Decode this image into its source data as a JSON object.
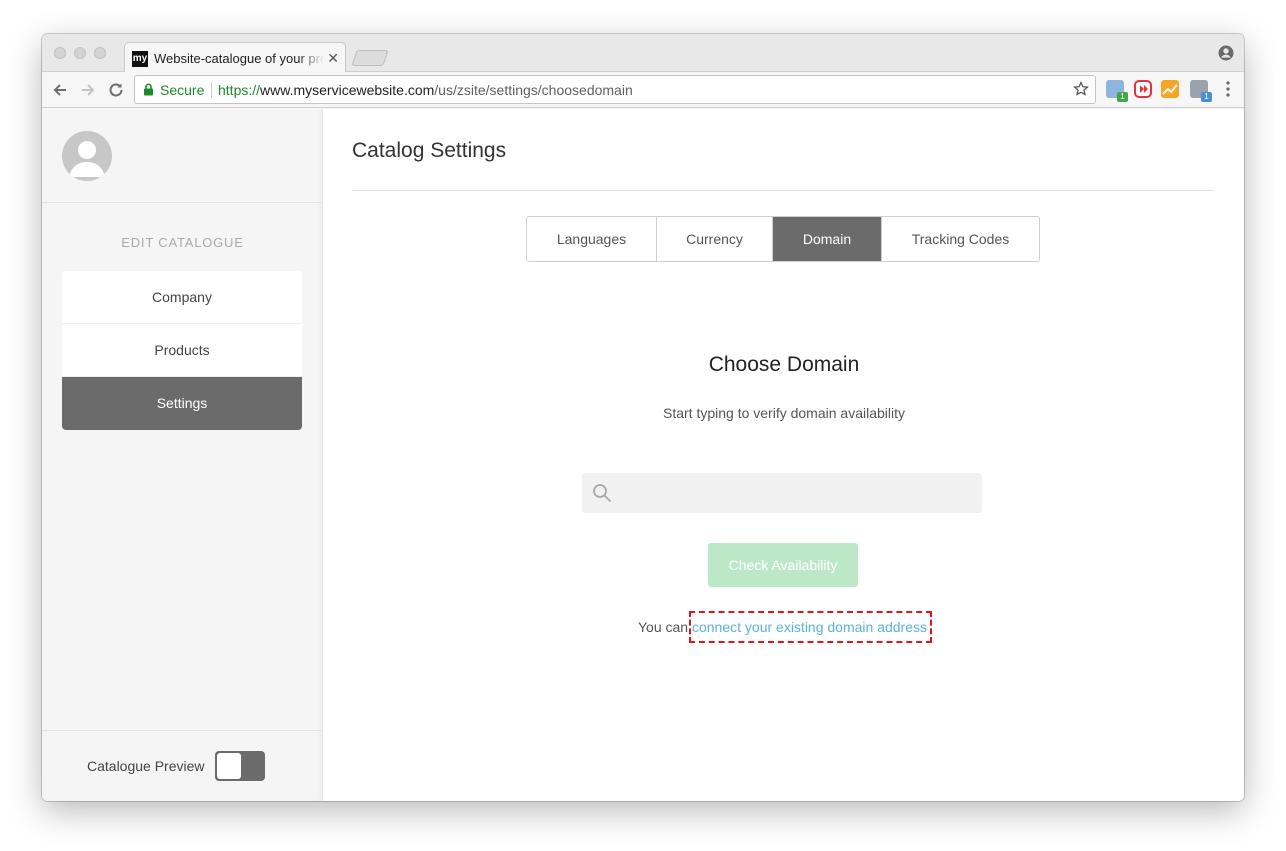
{
  "browser": {
    "tab_title": "Website-catalogue of your products",
    "tab_favicon": "my",
    "secure_label": "Secure",
    "url_scheme": "https://",
    "url_host": "www.myservicewebsite.com",
    "url_path": "/us/zsite/settings/choosedomain",
    "extension_badges": [
      "1",
      "1"
    ]
  },
  "sidebar": {
    "heading": "EDIT CATALOGUE",
    "items": [
      {
        "label": "Company",
        "active": false
      },
      {
        "label": "Products",
        "active": false
      },
      {
        "label": "Settings",
        "active": true
      }
    ],
    "preview_label": "Catalogue Preview",
    "preview_enabled": false
  },
  "main": {
    "title": "Catalog Settings",
    "tabs": [
      {
        "label": "Languages",
        "active": false
      },
      {
        "label": "Currency",
        "active": false
      },
      {
        "label": "Domain",
        "active": true
      },
      {
        "label": "Tracking Codes",
        "active": false
      }
    ],
    "domain": {
      "heading": "Choose Domain",
      "subtitle": "Start typing to verify domain availability",
      "search_value": "",
      "check_button": "Check Availability",
      "connect_prefix": "You can ",
      "connect_link": "connect your existing domain address"
    }
  },
  "colors": {
    "active_gray": "#6b6b6b",
    "button_green_disabled": "#bde8c8",
    "link_blue": "#5bb1d9",
    "highlight_red": "#e0141b",
    "secure_green": "#1e8a2e"
  }
}
